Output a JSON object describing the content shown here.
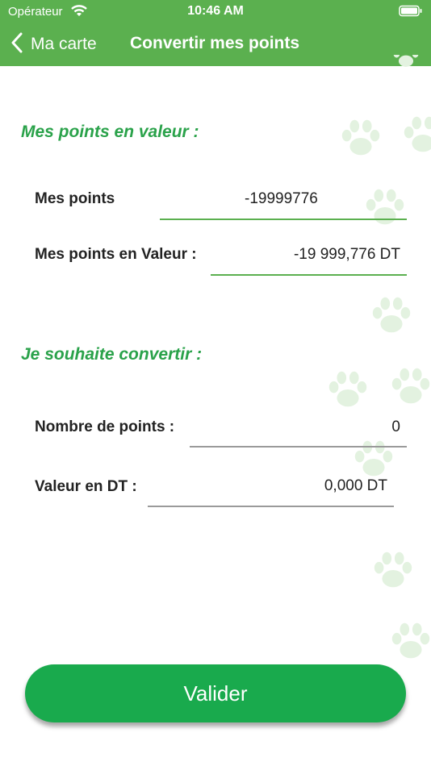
{
  "status_bar": {
    "carrier": "Opérateur",
    "time": "10:46 AM"
  },
  "nav": {
    "back_label": "Ma carte",
    "title": "Convertir mes points"
  },
  "section_points": {
    "title": "Mes points en valeur :",
    "points_label": "Mes points",
    "points_value": "-19999776",
    "value_label": "Mes points en Valeur :",
    "value_value": "-19 999,776 DT"
  },
  "section_convert": {
    "title": "Je souhaite convertir :",
    "nb_points_label": "Nombre de points :",
    "nb_points_value": "0",
    "value_dt_label": "Valeur en DT :",
    "value_dt_value": "0,000 DT"
  },
  "validate_label": "Valider",
  "colors": {
    "accent": "#5bb04f",
    "section_title": "#2aa24a",
    "button": "#19aa4d"
  }
}
